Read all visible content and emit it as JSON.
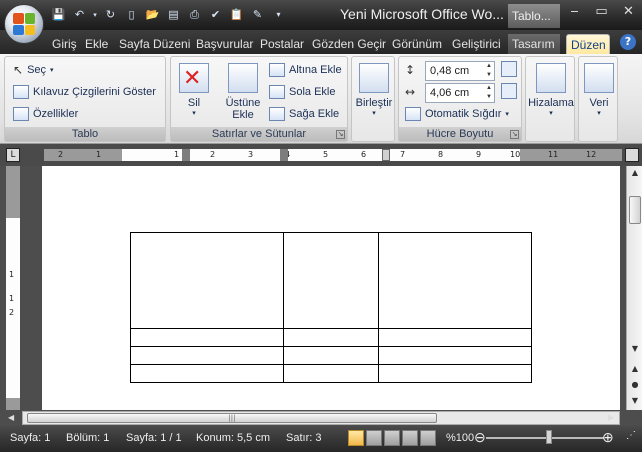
{
  "titlebar": {
    "title": "Yeni Microsoft Office Wo...",
    "context_title": "Tablo...",
    "minimize": "‒",
    "restore": "▭",
    "close": "✕"
  },
  "qat": {
    "icons": [
      "save-icon",
      "undo-icon",
      "redo-icon",
      "new-doc-icon",
      "open-icon",
      "print-preview-icon",
      "quick-print-icon",
      "spelling-icon",
      "paste-icon",
      "edit-icon",
      "customize-qat-icon"
    ]
  },
  "tabs": [
    {
      "label": "Giriş"
    },
    {
      "label": "Ekle"
    },
    {
      "label": "Sayfa Düzeni"
    },
    {
      "label": "Başvurular"
    },
    {
      "label": "Postalar"
    },
    {
      "label": "Gözden Geçir"
    },
    {
      "label": "Görünüm"
    },
    {
      "label": "Geliştirici"
    },
    {
      "label": "Tasarım"
    },
    {
      "label": "Düzen"
    }
  ],
  "ribbon": {
    "tablo": {
      "label": "Tablo",
      "sec": "Seç",
      "kilavuz": "Kılavuz Çizgilerini Göster",
      "ozellikler": "Özellikler"
    },
    "satirlar": {
      "label": "Satırlar ve Sütunlar",
      "sil": "Sil",
      "ustune_ekle_1": "Üstüne",
      "ustune_ekle_2": "Ekle",
      "altina_ekle": "Altına Ekle",
      "sola_ekle": "Sola Ekle",
      "saga_ekle": "Sağa Ekle"
    },
    "birlestir": {
      "label": "Birleştir"
    },
    "hucre_boyutu": {
      "label": "Hücre Boyutu",
      "height_value": "0,48 cm",
      "width_value": "4,06 cm",
      "otomatik": "Otomatik Sığdır"
    },
    "hizalama": {
      "label": "Hizalama"
    },
    "veri": {
      "label": "Veri"
    }
  },
  "ruler": {
    "corner": "L",
    "numbers": [
      "2",
      "1",
      "1",
      "2",
      "3",
      "4",
      "5",
      "6",
      "7",
      "8",
      "9",
      "10",
      "11",
      "12"
    ]
  },
  "vruler": {
    "numbers": [
      "1",
      "1",
      "2"
    ]
  },
  "status": {
    "sayfa": "Sayfa: 1",
    "bolum": "Bölüm: 1",
    "sayfa_of": "Sayfa: 1 / 1",
    "konum": "Konum: 5,5 cm",
    "satir": "Satır: 3",
    "zoom": "%100"
  }
}
